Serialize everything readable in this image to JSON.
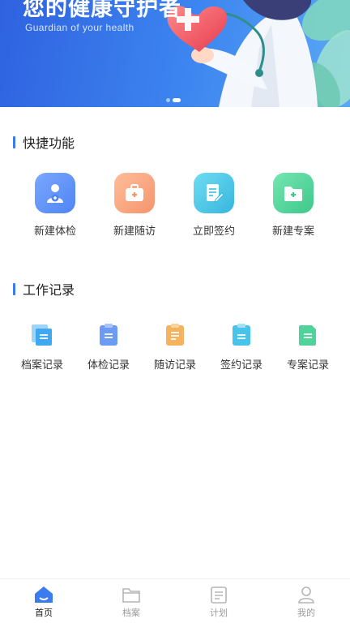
{
  "banner": {
    "title": "您的健康守护者",
    "subtitle": "Guardian of your health",
    "page_dots": 2,
    "active_dot": 2
  },
  "quick_section": {
    "title": "快捷功能",
    "items": [
      {
        "label": "新建体检",
        "icon": "person-badge-icon",
        "color": "#5b8ff5"
      },
      {
        "label": "新建随访",
        "icon": "medical-kit-icon",
        "color": "#f7a37e"
      },
      {
        "label": "立即签约",
        "icon": "sign-document-icon",
        "color": "#4fc3e3"
      },
      {
        "label": "新建专案",
        "icon": "folder-plus-icon",
        "color": "#4fd39a"
      }
    ]
  },
  "records_section": {
    "title": "工作记录",
    "items": [
      {
        "label": "档案记录",
        "icon": "archive-stack-icon",
        "color": "#3fa8f0"
      },
      {
        "label": "体检记录",
        "icon": "exam-clipboard-icon",
        "color": "#6c9bf3"
      },
      {
        "label": "随访记录",
        "icon": "followup-clipboard-icon",
        "color": "#f5b25f"
      },
      {
        "label": "签约记录",
        "icon": "sign-clipboard-icon",
        "color": "#48c3ea"
      },
      {
        "label": "专案记录",
        "icon": "case-file-icon",
        "color": "#4fd39a"
      }
    ]
  },
  "tabbar": {
    "tabs": [
      {
        "label": "首页",
        "icon": "home-icon",
        "active": true
      },
      {
        "label": "档案",
        "icon": "folder-icon",
        "active": false
      },
      {
        "label": "计划",
        "icon": "calendar-icon",
        "active": false
      },
      {
        "label": "我的",
        "icon": "user-icon",
        "active": false
      }
    ],
    "active_color": "#3b7bf0"
  }
}
